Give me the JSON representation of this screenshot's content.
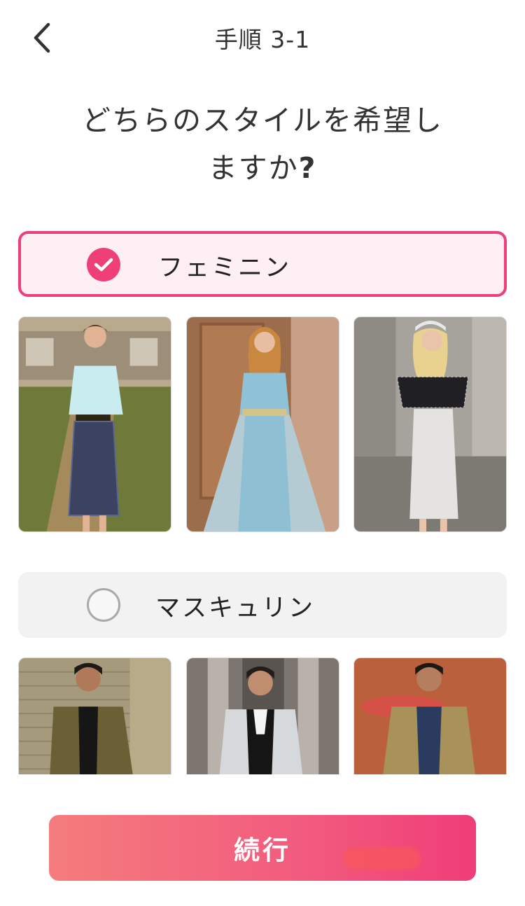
{
  "header": {
    "back_icon": "chevron-left-icon",
    "title": "手順 3-1"
  },
  "question": {
    "line1": "どちらのスタイルを希望し",
    "line2": "ますか",
    "mark": "?"
  },
  "options": [
    {
      "label": "フェミニン",
      "selected": true,
      "icon": "check-circle-icon",
      "photos": [
        "feminine-photo-retro-blouse-plaid-skirt",
        "feminine-photo-blue-gown-tiara",
        "feminine-photo-tweed-top-white-skirt"
      ]
    },
    {
      "label": "マスキュリン",
      "selected": false,
      "icon": "radio-empty-icon",
      "photos": [
        "masculine-photo-olive-shirt",
        "masculine-photo-silver-tuxedo",
        "masculine-photo-trench-coat"
      ]
    }
  ],
  "continue_button": {
    "label": "続行"
  },
  "colors": {
    "accent": "#ee3f77",
    "selected_bg": "#fdeff3",
    "unselected_bg": "#f2f2f2",
    "button_gradient_start": "#f47c7c",
    "button_gradient_end": "#ef3d78"
  }
}
